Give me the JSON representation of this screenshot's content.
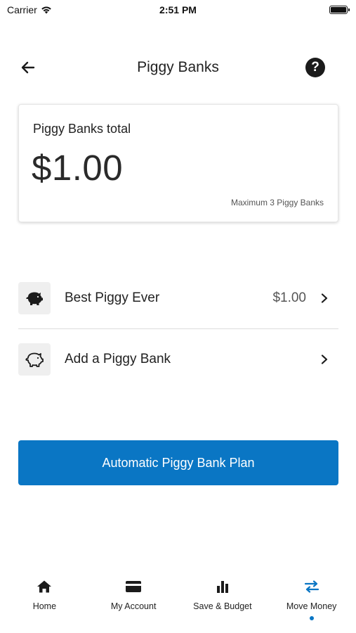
{
  "status_bar": {
    "carrier": "Carrier",
    "time": "2:51 PM"
  },
  "header": {
    "title": "Piggy Banks",
    "back_icon": "arrow-left-icon",
    "help_label": "?"
  },
  "total_card": {
    "label": "Piggy Banks total",
    "amount": "$1.00",
    "max_note": "Maximum 3 Piggy Banks"
  },
  "piggy_list": [
    {
      "name": "Best Piggy Ever",
      "balance": "$1.00",
      "icon": "piggy-bank-filled-icon"
    },
    {
      "name": "Add a Piggy Bank",
      "balance": "",
      "icon": "piggy-bank-outline-icon"
    }
  ],
  "cta": {
    "label": "Automatic Piggy Bank Plan"
  },
  "tab_bar": {
    "tabs": [
      {
        "label": "Home",
        "icon": "home-icon"
      },
      {
        "label": "My Account",
        "icon": "card-icon"
      },
      {
        "label": "Save & Budget",
        "icon": "bar-chart-icon"
      },
      {
        "label": "Move Money",
        "icon": "transfer-arrows-icon"
      }
    ],
    "active_tab": "Move Money"
  },
  "colors": {
    "accent": "#0a76c4",
    "text": "#222222",
    "muted": "#555555"
  }
}
